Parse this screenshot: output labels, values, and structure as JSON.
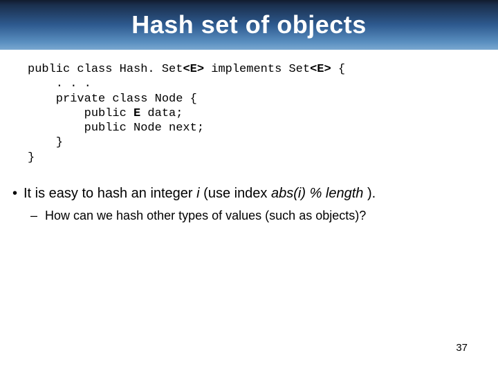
{
  "slide": {
    "title": "Hash set of objects",
    "code": {
      "line1_a": "public class Hash. Set",
      "line1_b": "<E>",
      "line1_c": " implements Set",
      "line1_d": "<E>",
      "line1_e": " {",
      "line2": "    . . .",
      "line3": "    private class Node {",
      "line4_a": "        public ",
      "line4_b": "E",
      "line4_c": " data;",
      "line5": "        public Node next;",
      "line6": "    }",
      "line7": "}"
    },
    "bullet": {
      "mark": "•",
      "text_a": "It is easy to hash an integer ",
      "text_b": "i ",
      "text_c": " (use index ",
      "text_d": "abs(i) % length ",
      "text_e": ")."
    },
    "sub": {
      "dash": "–",
      "text": " How can we hash other types of values (such as objects)?"
    },
    "page": "37"
  }
}
